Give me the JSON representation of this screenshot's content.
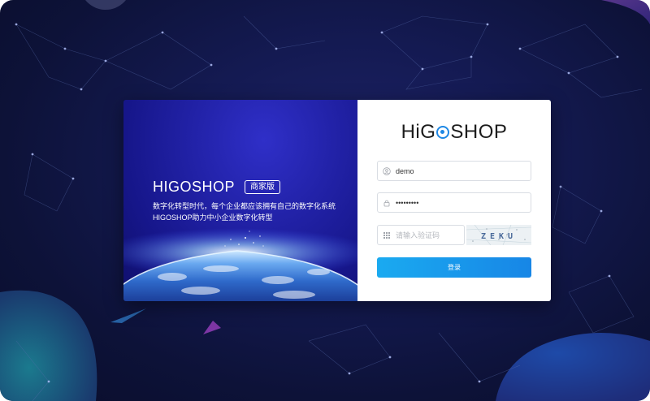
{
  "colors": {
    "page_background": "#141a52",
    "promo_background": "#2222a8",
    "accent": "#1e88e5",
    "button": "#1a9bef"
  },
  "promo": {
    "brand": "HIGOSHOP",
    "edition": "商家版",
    "tagline_1": "数字化转型时代，每个企业都应该拥有自己的数字化系统",
    "tagline_2": "HIGOSHOP助力中小企业数字化转型"
  },
  "logo": {
    "prefix": "Hi",
    "g": "G",
    "suffix": "SHOP"
  },
  "form": {
    "username_value": "demo",
    "password_value": "•••••••••",
    "captcha_placeholder": "请输入验证码",
    "captcha_text": "ZEKU",
    "login_label": "登录",
    "icons": {
      "username": "user-icon",
      "password": "lock-icon",
      "captcha": "grid-icon"
    }
  }
}
